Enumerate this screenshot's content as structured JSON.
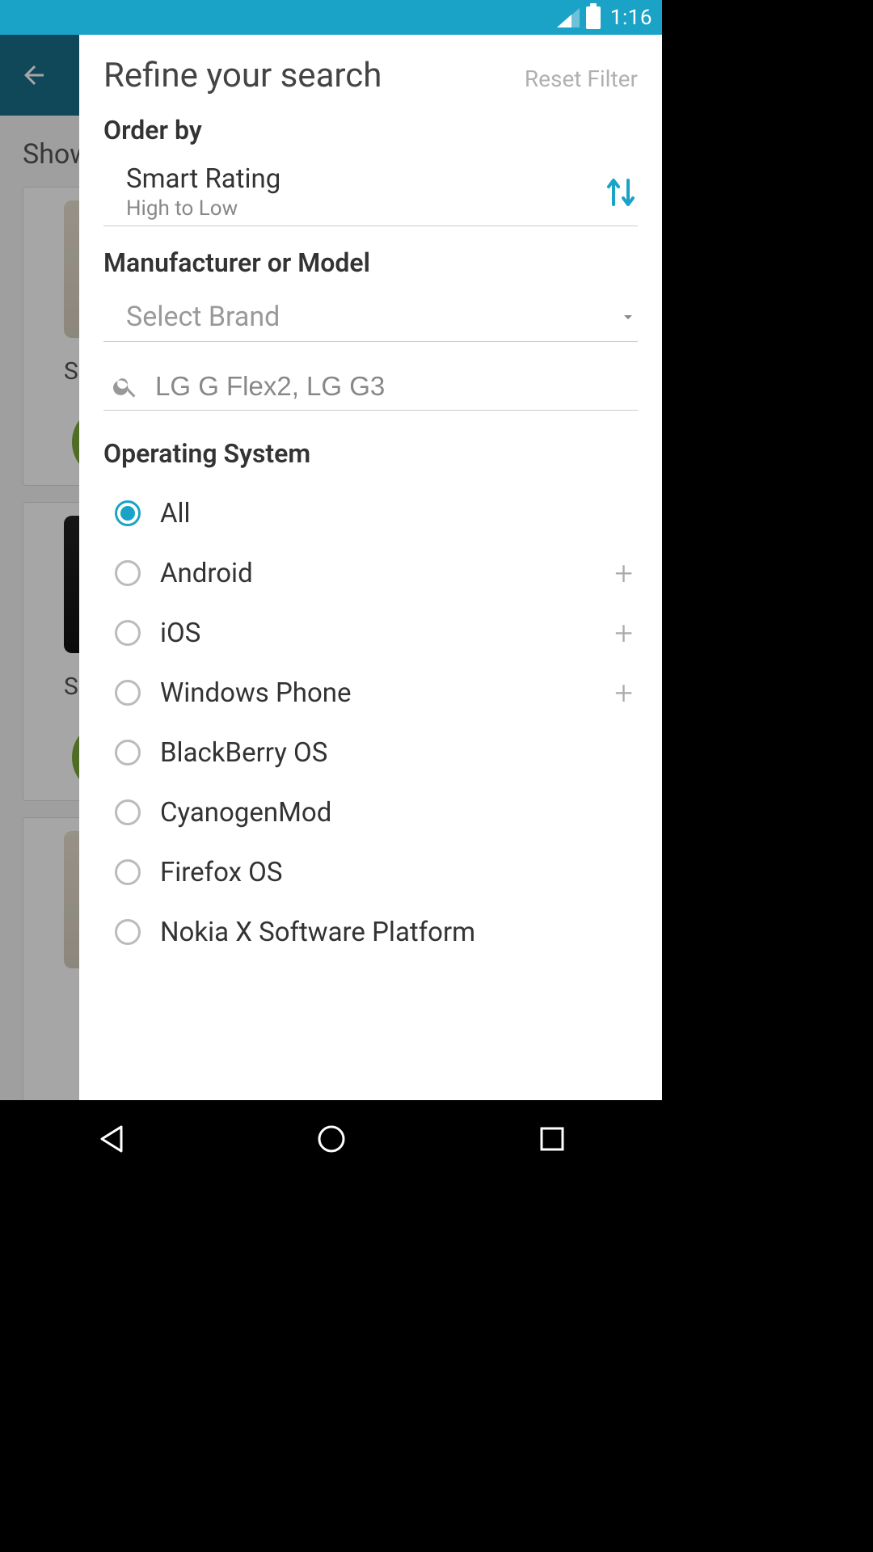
{
  "status": {
    "time": "1:16"
  },
  "bg": {
    "show": "Show",
    "sma": "Sma"
  },
  "panel": {
    "title": "Refine your search",
    "reset": "Reset Filter",
    "orderByLabel": "Order by",
    "order": {
      "main": "Smart Rating",
      "sub": "High to Low"
    },
    "manuLabel": "Manufacturer or Model",
    "brandPlaceholder": "Select Brand",
    "searchPlaceholder": "LG G Flex2, LG G3",
    "osLabel": "Operating System",
    "os": [
      {
        "label": "All",
        "selected": true,
        "expandable": false
      },
      {
        "label": "Android",
        "selected": false,
        "expandable": true
      },
      {
        "label": "iOS",
        "selected": false,
        "expandable": true
      },
      {
        "label": "Windows Phone",
        "selected": false,
        "expandable": true
      },
      {
        "label": "BlackBerry OS",
        "selected": false,
        "expandable": false
      },
      {
        "label": "CyanogenMod",
        "selected": false,
        "expandable": false
      },
      {
        "label": "Firefox OS",
        "selected": false,
        "expandable": false
      },
      {
        "label": "Nokia X Software Platform",
        "selected": false,
        "expandable": false
      }
    ]
  }
}
